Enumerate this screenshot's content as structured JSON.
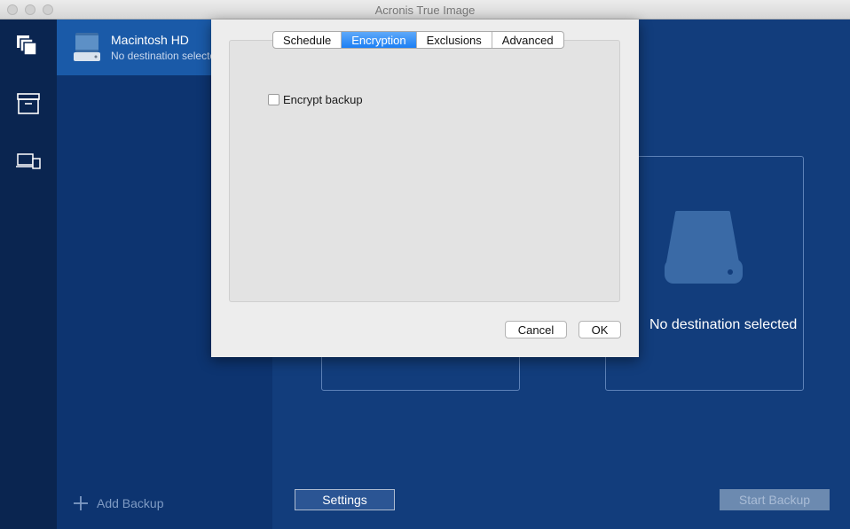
{
  "window": {
    "title": "Acronis True Image"
  },
  "sidebar": {
    "nav_icons": [
      "backup-icon",
      "archive-icon",
      "devices-icon"
    ]
  },
  "backup_list": {
    "items": [
      {
        "name": "Macintosh HD",
        "status": "No destination selected",
        "icon": "hard-drive-icon"
      }
    ],
    "add_label": "Add Backup"
  },
  "main": {
    "destination_label": "No destination selected",
    "settings_label": "Settings",
    "start_label": "Start Backup"
  },
  "dialog": {
    "tabs": [
      {
        "label": "Schedule",
        "active": false
      },
      {
        "label": "Encryption",
        "active": true
      },
      {
        "label": "Exclusions",
        "active": false
      },
      {
        "label": "Advanced",
        "active": false
      }
    ],
    "encrypt_label": "Encrypt backup",
    "encrypt_checked": false,
    "cancel_label": "Cancel",
    "ok_label": "OK"
  },
  "colors": {
    "selected_tab": "#1c7ff4",
    "main_background": "#123d7c",
    "selected_item": "#1a5aa8"
  }
}
